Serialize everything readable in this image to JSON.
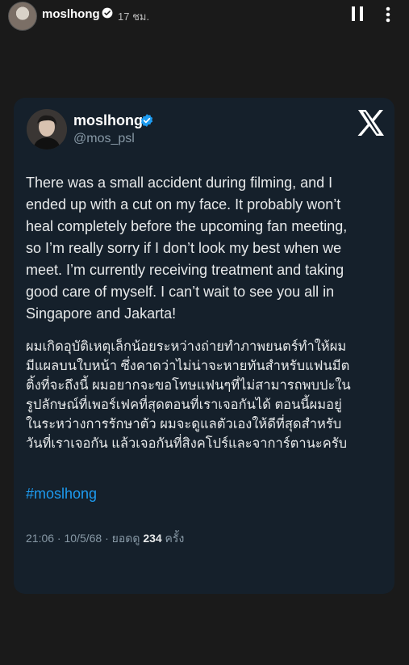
{
  "story": {
    "username": "moslhong",
    "time_ago": "17 ชม."
  },
  "tweet": {
    "display_name": "moslhong",
    "handle": "@mos_psl",
    "text_en": "There was a small accident during filming, and I\nended up with a cut on my face. It probably won’t\nheal completely before the upcoming fan meeting,\nso I’m really sorry if I don’t look my best when we\nmeet. I’m currently receiving treatment and taking\ngood care of myself. I can’t wait to see you all in\nSingapore and Jakarta!",
    "text_th": "ผมเกิดอุบัติเหตุเล็กน้อยระหว่างถ่ายทำภาพยนตร์ทำให้ผม\nมีแผลบนใบหน้า ซึ่งคาดว่าไม่น่าจะหายทันสำหรับแฟนมีต\nติ้งที่จะถึงนี้ ผมอยากจะขอโทษแฟนๆที่ไม่สามารถพบปะใน\nรูปลักษณ์ที่เพอร์เฟคที่สุดตอนที่เราเจอกันได้ ตอนนี้ผมอยู่\nในระหว่างการรักษาตัว ผมจะดูแลตัวเองให้ดีที่สุดสำหรับ\nวันที่เราเจอกัน แล้วเจอกันที่สิงคโปร์และจาการ์ตานะครับ",
    "hashtag": "#moslhong",
    "meta_prefix": "21:06 · 10/5/68 · ยอดดู ",
    "views": "234",
    "meta_suffix": " ครั้ง"
  },
  "icons": {
    "verified": "verified-badge-icon",
    "pause": "pause-icon",
    "more": "more-vertical-icon",
    "x_logo": "x-logo-icon"
  },
  "colors": {
    "card_bg": "#15202b",
    "page_bg": "#1a1a1a",
    "link": "#1d9bf0",
    "verified": "#1d9bf0",
    "muted": "#8899a6"
  }
}
